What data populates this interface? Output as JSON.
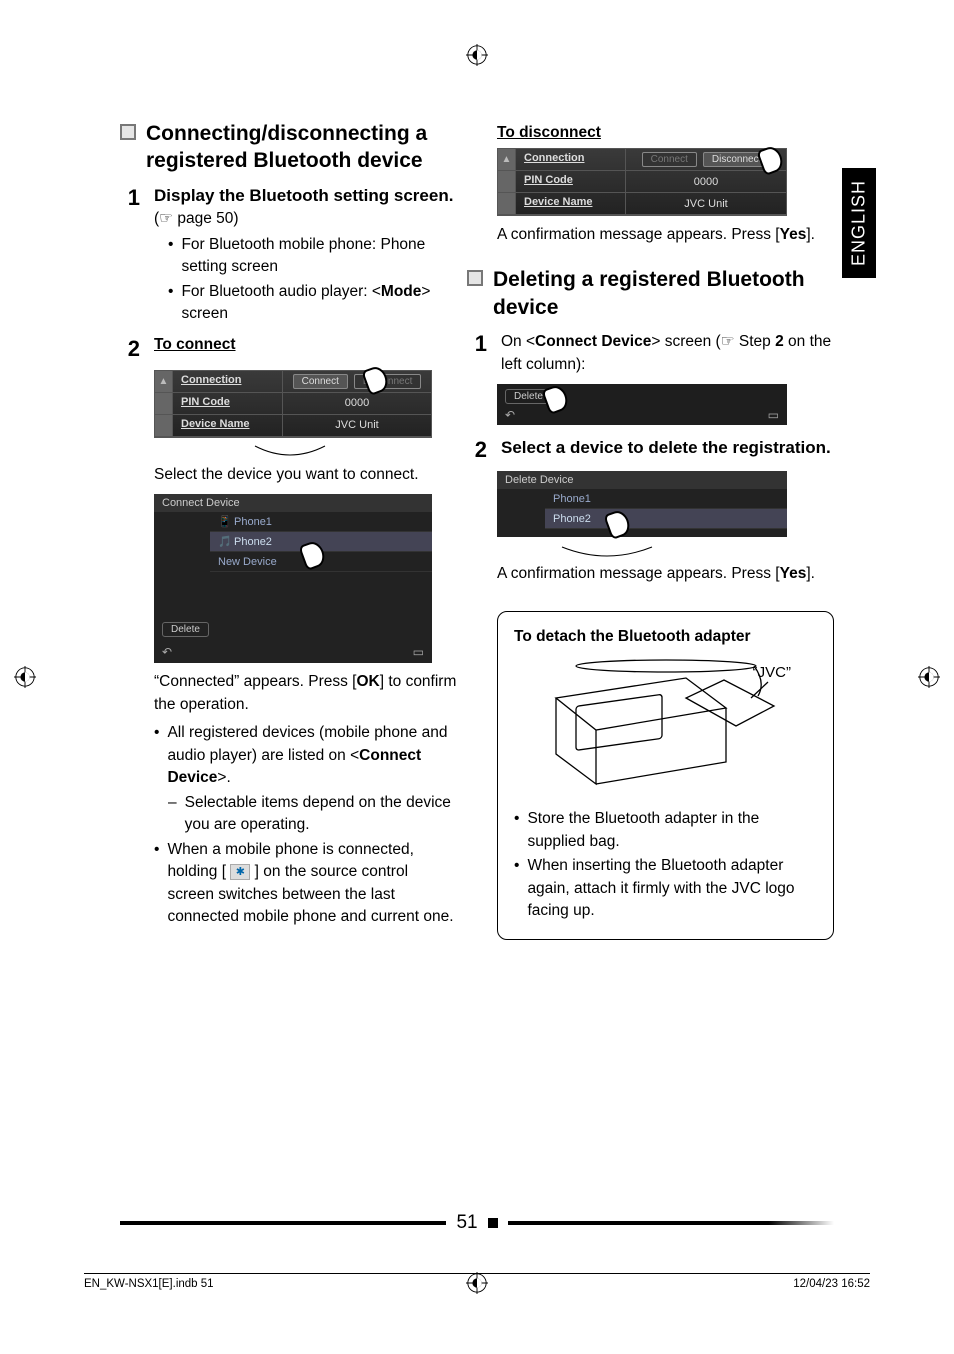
{
  "lang_tab": "ENGLISH",
  "left": {
    "section_title": "Connecting/disconnecting a registered Bluetooth device",
    "step1_num": "1",
    "step1_title": "Display the Bluetooth setting screen.",
    "step1_ref": "(☞ page 50)",
    "step1_b1": "For Bluetooth mobile phone: Phone setting screen",
    "step1_b2_pre": "For Bluetooth audio player: <",
    "step1_b2_bold": "Mode",
    "step1_b2_post": "> screen",
    "step2_num": "2",
    "step2_title": "To connect",
    "ui1": {
      "row1_label": "Connection",
      "row1_btn1": "Connect",
      "row1_btn2": "Disconnect",
      "row2_label": "PIN Code",
      "row2_val": "0000",
      "row3_label": "Device Name",
      "row3_val": "JVC Unit"
    },
    "select_text": "Select the device you want to connect.",
    "ui2": {
      "title": "Connect Device",
      "item1": "Phone1",
      "item2": "Phone2",
      "item3": "New Device",
      "delete": "Delete"
    },
    "connected_text_pre": "“Connected” appears. Press [",
    "connected_text_bold": "OK",
    "connected_text_post": "] to confirm the operation.",
    "bul1_pre": "All registered devices (mobile phone and audio player) are listed on <",
    "bul1_bold": "Connect Device",
    "bul1_post": ">.",
    "dash1": "Selectable items depend on the device you are operating.",
    "bul2": "When a mobile phone is connected, holding [ ",
    "bul2_post": " ] on the source control screen switches between the last connected mobile phone and current one."
  },
  "right": {
    "disconnect_title": "To disconnect",
    "ui1": {
      "row1_label": "Connection",
      "row1_btn1": "Connect",
      "row1_btn2": "Disconnect",
      "row2_label": "PIN Code",
      "row2_val": "0000",
      "row3_label": "Device Name",
      "row3_val": "JVC Unit"
    },
    "confirm1_pre": "A confirmation message appears. Press [",
    "confirm1_bold": "Yes",
    "confirm1_post": "].",
    "section_title": "Deleting a registered Bluetooth device",
    "step1_num": "1",
    "step1_pre": "On <",
    "step1_bold1": "Connect Device",
    "step1_mid": "> screen (☞ Step ",
    "step1_bold2": "2",
    "step1_post": " on the left column):",
    "ui2": {
      "delete": "Delete"
    },
    "step2_num": "2",
    "step2_title": "Select a device to delete the registration.",
    "ui3": {
      "title": "Delete Device",
      "item1": "Phone1",
      "item2": "Phone2"
    },
    "confirm2_pre": "A confirmation message appears. Press [",
    "confirm2_bold": "Yes",
    "confirm2_post": "].",
    "detach_title": "To detach the Bluetooth adapter",
    "jvc": "“JVC”",
    "detach_b1": "Store the Bluetooth adapter in the supplied bag.",
    "detach_b2": "When inserting the Bluetooth adapter again, attach it firmly with the JVC logo facing up."
  },
  "page_number": "51",
  "footer_left": "EN_KW-NSX1[E].indb   51",
  "footer_right": "12/04/23   16:52"
}
